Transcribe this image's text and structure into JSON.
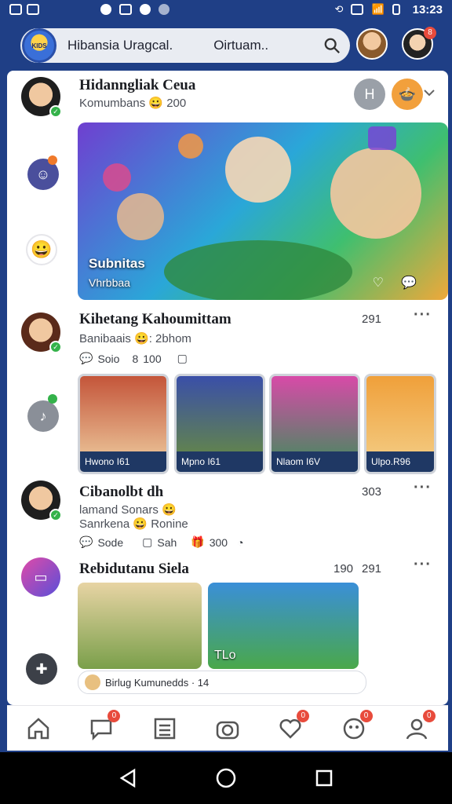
{
  "status_bar": {
    "time": "13:23"
  },
  "search": {
    "logo_text": "KIDS",
    "query_left": "Hibansia Uragcal.",
    "query_right": "Oirtuam.."
  },
  "header": {
    "notif_badge": "8"
  },
  "posts": [
    {
      "name": "Hidanngliak Ceua",
      "subtitle": "Komumbans 😀 200",
      "hero_title": "Subnitas",
      "hero_sub": "Vhrbbaa"
    },
    {
      "name": "Kihetang Kahoumittam",
      "count": "291",
      "subtitle": "Banibaais 😀: 2bhom",
      "meta": [
        "Soio",
        "100"
      ],
      "thumbs": [
        {
          "caption": "Hwono I61"
        },
        {
          "caption": "Mpno I61"
        },
        {
          "caption": "Nlaom I6V"
        },
        {
          "caption": "Ulpo.R96"
        }
      ]
    },
    {
      "name": "Cibanolbt dh",
      "count": "303",
      "line1": "lamand Sonars 😀",
      "line2": "Sanrkena 😀 Ronine",
      "meta": [
        "Sode",
        "Sah",
        "300"
      ]
    },
    {
      "name": "Rebidutanu Siela",
      "count_left": "190",
      "count": "291",
      "thumb_label": "TLo",
      "footer": "Birlug Kumunedds · 14"
    }
  ],
  "nav_badges": [
    "0",
    "0",
    "0",
    "0"
  ],
  "colors": {
    "header_bg": "#1f3f86",
    "badge": "#e84b3c",
    "check": "#34b24a"
  }
}
